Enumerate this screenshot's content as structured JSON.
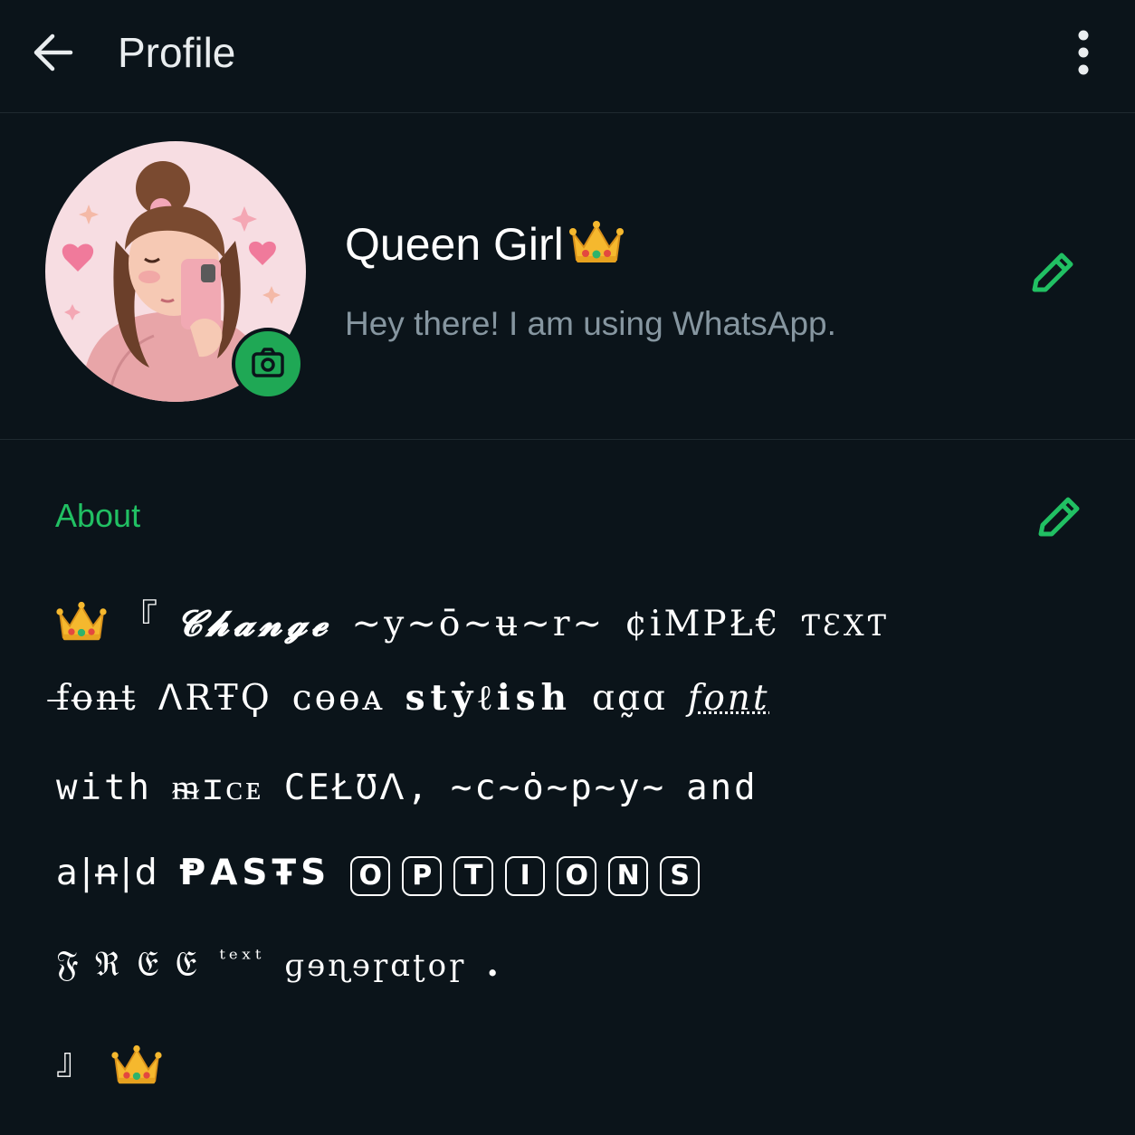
{
  "header": {
    "title": "Profile"
  },
  "profile": {
    "name": "Queen Girl",
    "status": "Hey there! I am using WhatsApp."
  },
  "about": {
    "label": "About",
    "line1": {
      "open_bracket": "『",
      "a": "𝓒𝓱𝓪𝓷𝓰𝓮",
      "b": "~y~ō~ʉ~r~",
      "c": "¢iMPŁ€",
      "d": "ƬƐΧƬ"
    },
    "line2": {
      "a": "f̶o̶n̶t̶",
      "b": "ᐱRŦϘ",
      "c": "ᴄɵɵᴀ",
      "d": "stẏℓish",
      "e": "ɑɑ̰ɑ",
      "f": "font"
    },
    "line3": {
      "a": "with",
      "b": "ᵯɪᴄᴇ",
      "c": "CEŁƱꓥ,",
      "d": "~c~ȯ~p~y~",
      "e": "and"
    },
    "line4": {
      "a": "a|n̶|d",
      "b": "ⱣASŦS",
      "options": [
        "O",
        "P",
        "T",
        "I",
        "O",
        "N",
        "S"
      ]
    },
    "line5": {
      "a": "𝔉 ℜ 𝔈 𝔈",
      "b": "ᵗᵉˣᵗ",
      "c": "ɡɘɳɘɼɑʈoɼ",
      "d": "."
    },
    "line6": {
      "close_bracket": "』"
    }
  },
  "colors": {
    "background": "#0b141a",
    "accent": "#21c063",
    "camera_button": "#1fa855",
    "secondary_text": "#8696a0"
  },
  "icons": [
    "back-arrow-icon",
    "more-vert-icon",
    "camera-icon",
    "pencil-icon",
    "crown-emoji"
  ]
}
